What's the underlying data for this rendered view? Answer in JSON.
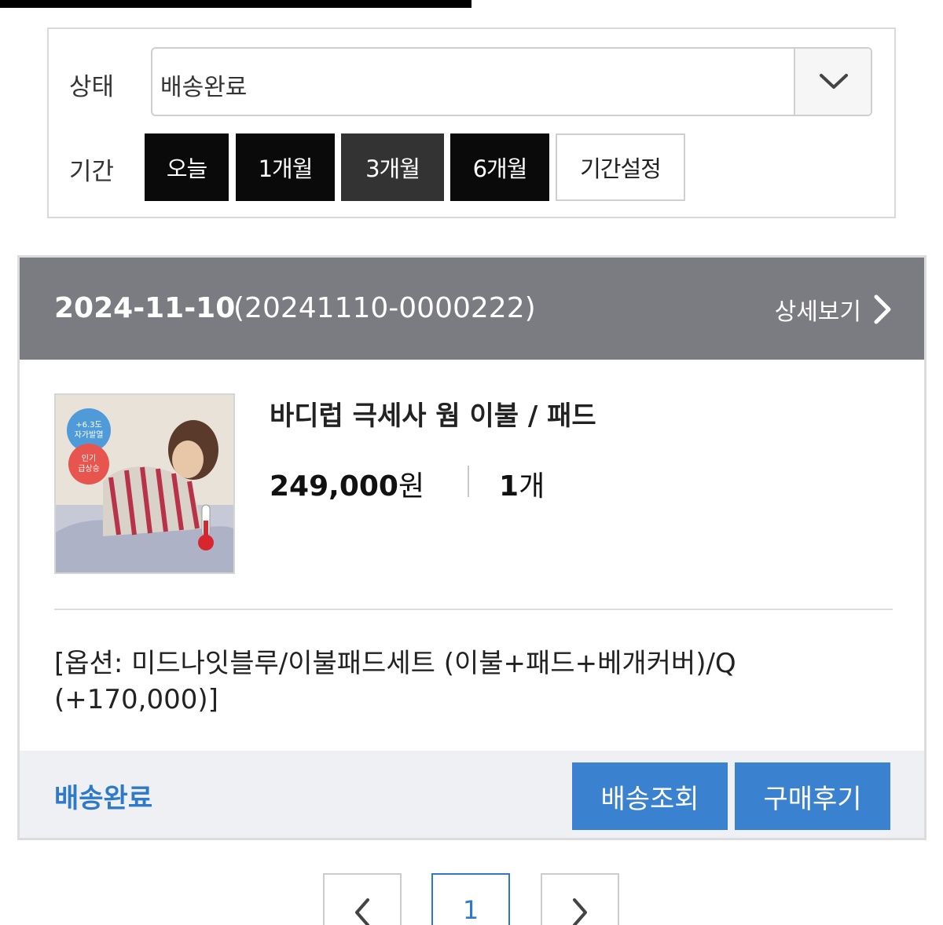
{
  "filter": {
    "status_label": "상태",
    "status_value": "배송완료",
    "period_label": "기간",
    "period_buttons": [
      "오늘",
      "1개월",
      "3개월",
      "6개월",
      "기간설정"
    ]
  },
  "order": {
    "date": "2024-11-10",
    "order_number": "(20241110-0000222)",
    "detail_link": "상세보기",
    "product": {
      "name": "바디럽 극세사 웜 이불 / 패드",
      "price": "249,000",
      "price_unit": "원",
      "quantity": "1",
      "quantity_unit": "개",
      "option_line1": "[옵션: 미드나잇블루/이불패드세트 (이불+패드+베개커버)/Q",
      "option_line2": "(+170,000)]",
      "thumb_badge_top_1": "+6.3도",
      "thumb_badge_top_2": "자가발열",
      "thumb_badge_mid_1": "인기",
      "thumb_badge_mid_2": "급상승"
    },
    "footer": {
      "status": "배송완료",
      "track_button": "배송조회",
      "review_button": "구매후기"
    }
  },
  "pagination": {
    "current_page": "1"
  },
  "colors": {
    "accent_blue": "#3a82cf",
    "status_blue": "#2e79c8",
    "header_gray": "#7a7c82",
    "dark_button": "#0a0a0a"
  }
}
